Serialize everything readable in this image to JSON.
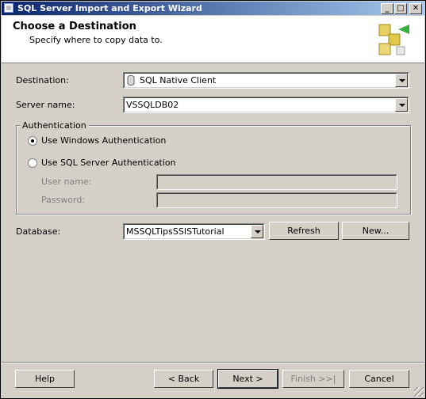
{
  "window": {
    "title": "SQL Server Import and Export Wizard"
  },
  "header": {
    "title": "Choose a Destination",
    "subtitle": "Specify where to copy data to."
  },
  "form": {
    "destination_label": "Destination:",
    "destination_value": "SQL Native Client",
    "server_label": "Server name:",
    "server_value": "VSSQLDB02",
    "auth_group_label": "Authentication",
    "windows_auth_label": "Use Windows Authentication",
    "sql_auth_label": "Use SQL Server Authentication",
    "username_label": "User name:",
    "username_value": "",
    "password_label": "Password:",
    "password_value": "",
    "database_label": "Database:",
    "database_value": "MSSQLTipsSSISTutorial",
    "refresh_label": "Refresh",
    "new_label": "New..."
  },
  "footer": {
    "help_label": "Help",
    "back_label": "< Back",
    "next_label": "Next >",
    "finish_label": "Finish >>|",
    "cancel_label": "Cancel"
  }
}
